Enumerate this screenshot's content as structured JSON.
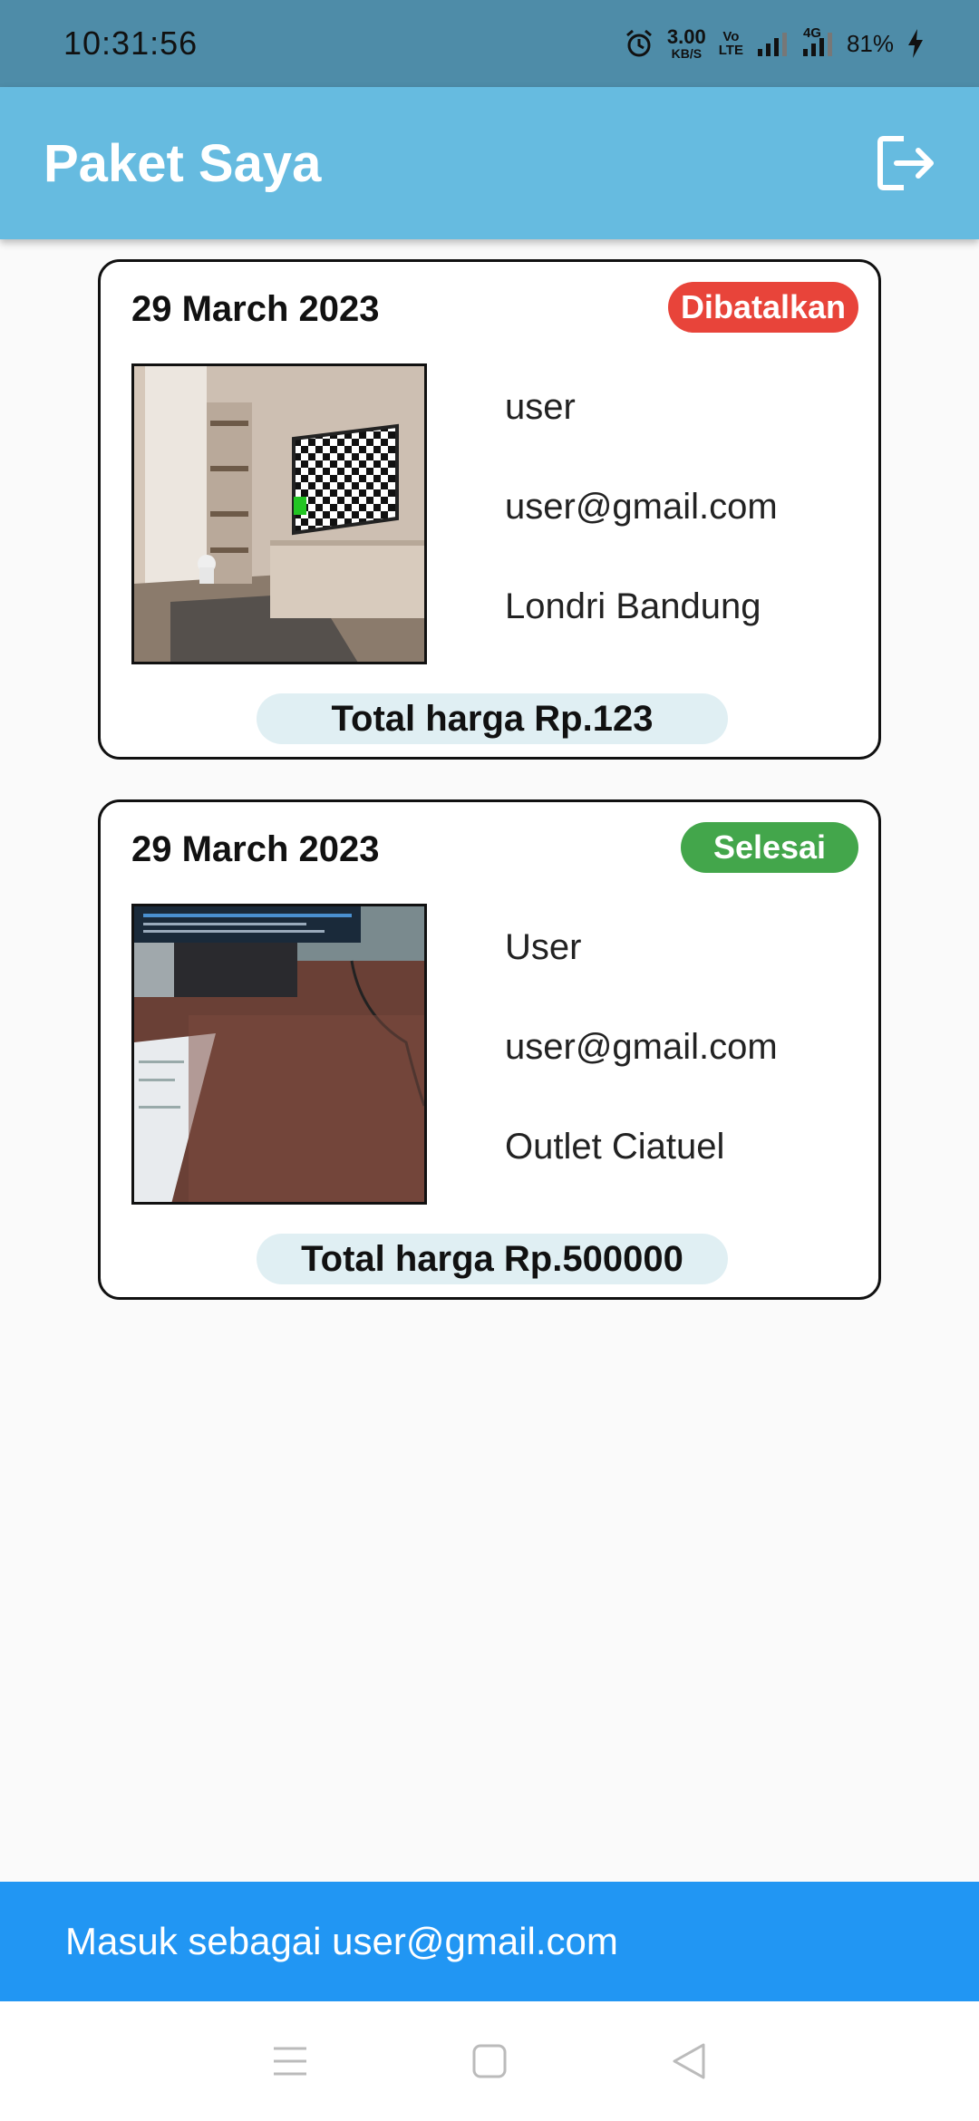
{
  "status_bar": {
    "time": "10:31:56",
    "net_speed_value": "3.00",
    "net_speed_unit": "KB/S",
    "volte_top": "Vo",
    "volte_bottom": "LTE",
    "network_type": "4G",
    "battery": "81%",
    "icons": [
      "alarm-icon",
      "signal-icon",
      "signal-4g-icon",
      "charging-icon"
    ]
  },
  "app_bar": {
    "title": "Paket Saya",
    "logout_icon": "logout-icon"
  },
  "orders": [
    {
      "date": "29 March 2023",
      "status": "Dibatalkan",
      "status_color": "#e8443a",
      "name": "user",
      "email": "user@gmail.com",
      "outlet": "Londri Bandung",
      "total": "Total harga Rp.123"
    },
    {
      "date": "29 March 2023",
      "status": "Selesai",
      "status_color": "#43a64b",
      "name": "User",
      "email": "user@gmail.com",
      "outlet": "Outlet Ciatuel",
      "total": "Total harga Rp.500000"
    }
  ],
  "footer": {
    "text": "Masuk sebagai user@gmail.com"
  },
  "nav": {
    "icons": [
      "menu-icon",
      "home-icon",
      "back-icon"
    ]
  },
  "colors": {
    "status_bar": "#4e8ca8",
    "app_bar": "#66bbe0",
    "footer": "#2196f3",
    "total_pill": "#e0eff3"
  }
}
